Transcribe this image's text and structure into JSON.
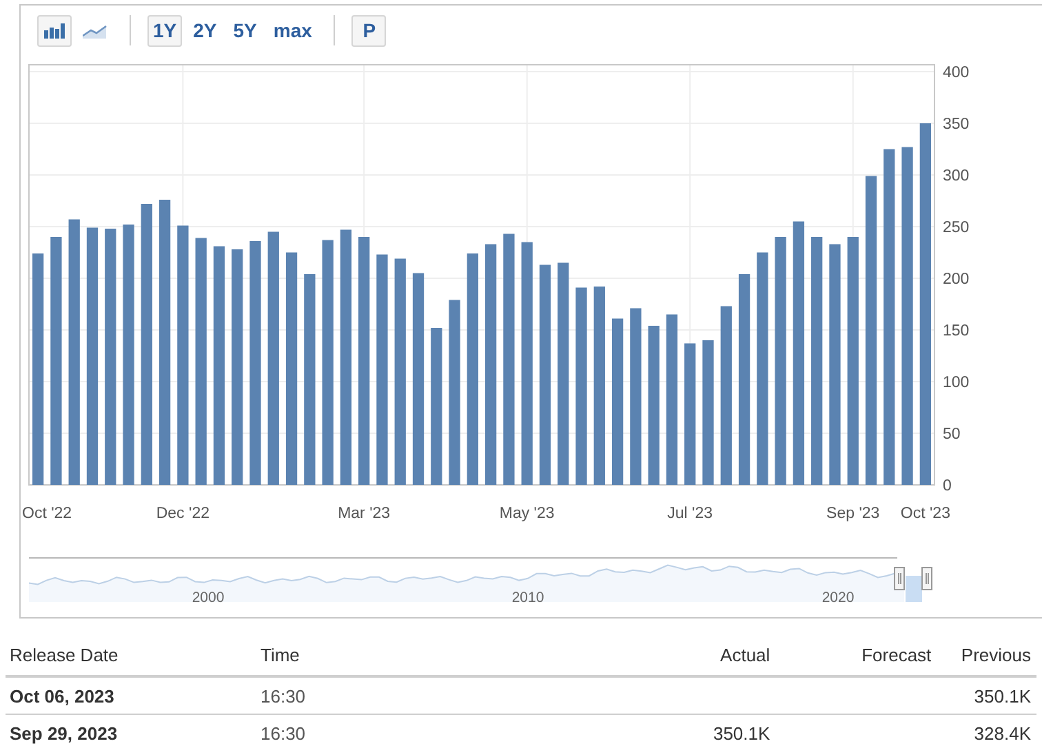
{
  "toolbar": {
    "chart_types": [
      {
        "kind": "bar",
        "selected": true
      },
      {
        "kind": "line",
        "selected": false
      }
    ],
    "ranges": [
      {
        "label": "1Y",
        "selected": true
      },
      {
        "label": "2Y",
        "selected": false
      },
      {
        "label": "5Y",
        "selected": false
      },
      {
        "label": "max",
        "selected": false
      }
    ],
    "print_button": "P"
  },
  "chart": {
    "chart_data": {
      "type": "bar",
      "categories": [
        "Oct '22",
        null,
        null,
        null,
        null,
        null,
        null,
        null,
        "Dec '22",
        null,
        null,
        null,
        null,
        null,
        null,
        null,
        null,
        null,
        "Mar '23",
        null,
        null,
        null,
        null,
        null,
        null,
        null,
        null,
        "May '23",
        null,
        null,
        null,
        null,
        null,
        null,
        null,
        null,
        "Jul '23",
        null,
        null,
        null,
        null,
        null,
        null,
        null,
        null,
        "Sep '23",
        null,
        null,
        null,
        "Oct '23"
      ],
      "values": [
        224,
        240,
        257,
        249,
        248,
        252,
        272,
        276,
        251,
        239,
        231,
        228,
        236,
        245,
        225,
        204,
        237,
        247,
        240,
        223,
        219,
        205,
        152,
        179,
        224,
        233,
        243,
        235,
        213,
        215,
        191,
        192,
        161,
        171,
        154,
        165,
        137,
        140,
        173,
        204,
        225,
        240,
        255,
        240,
        233,
        240,
        299,
        325,
        327,
        350
      ],
      "grid": true,
      "ylim": [
        0,
        400
      ],
      "yticks": [
        0,
        50,
        100,
        150,
        200,
        250,
        300,
        350,
        400
      ]
    }
  },
  "navigator": {
    "labels": [
      "2000",
      "2010",
      "2020"
    ]
  },
  "table": {
    "columns": [
      "Release Date",
      "Time",
      "Actual",
      "Forecast",
      "Previous"
    ],
    "rows": [
      {
        "release_date": "Oct 06, 2023",
        "time": "16:30",
        "previous": "350.1K"
      },
      {
        "release_date": "Sep 29, 2023",
        "time": "16:30",
        "actual": "350.1K",
        "previous": "328.4K"
      }
    ]
  }
}
